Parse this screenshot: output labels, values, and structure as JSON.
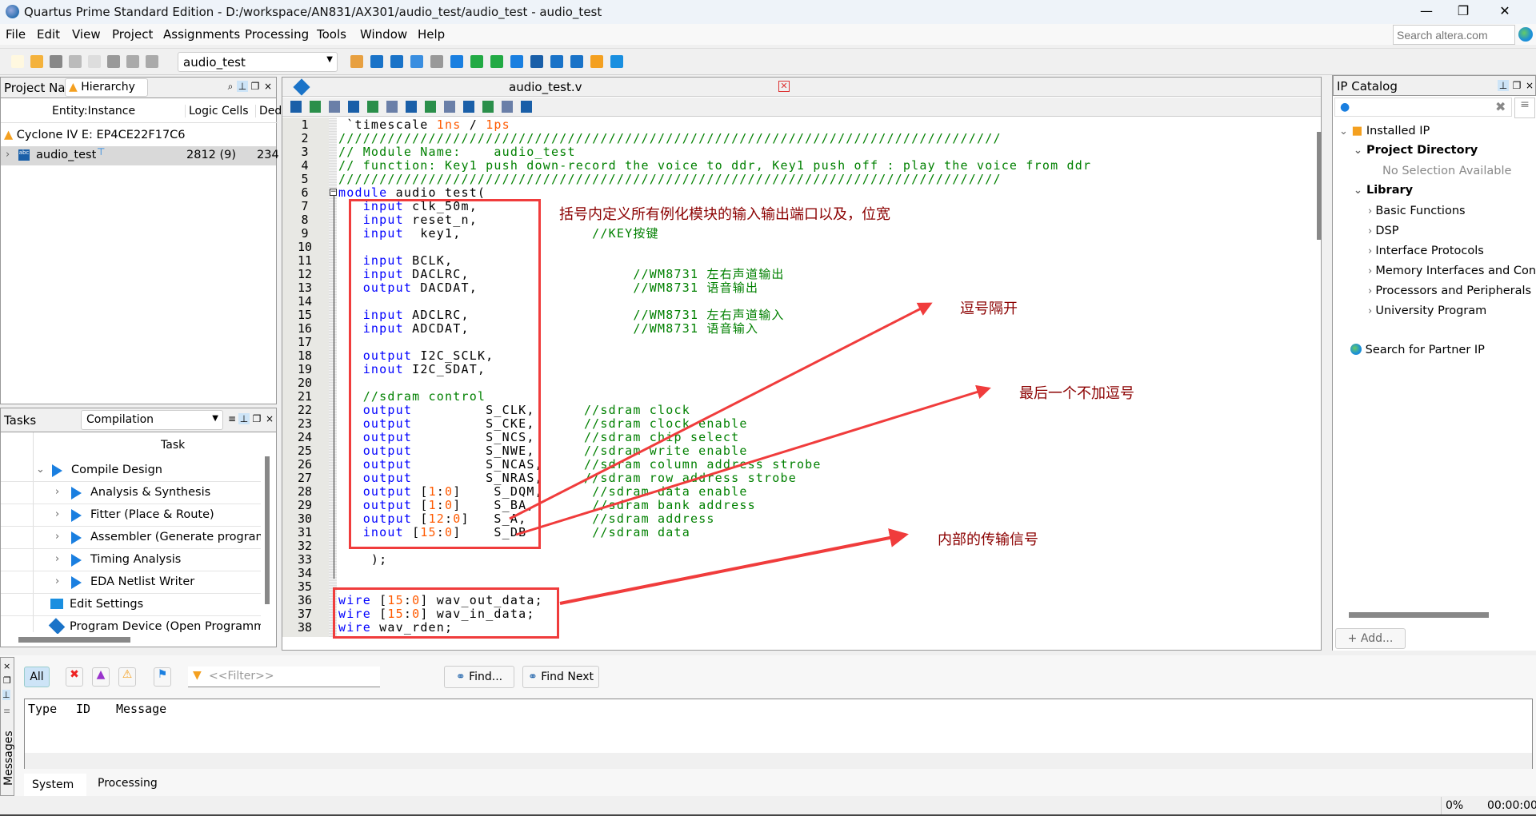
{
  "window": {
    "title": "Quartus Prime Standard Edition - D:/workspace/AN831/AX301/audio_test/audio_test - audio_test",
    "minimize": "—",
    "restore": "❐",
    "close": "✕"
  },
  "menu": [
    "File",
    "Edit",
    "View",
    "Project",
    "Assignments",
    "Processing",
    "Tools",
    "Window",
    "Help"
  ],
  "search": {
    "placeholder": "Search altera.com"
  },
  "toolbar": {
    "project_combo": "audio_test",
    "icons": [
      {
        "name": "new-file-icon",
        "color": "#fff8e0"
      },
      {
        "name": "open-folder-icon",
        "color": "#f4b23c"
      },
      {
        "name": "save-icon",
        "color": "#888"
      },
      {
        "name": "cut-icon",
        "color": "#bbb"
      },
      {
        "name": "copy-icon",
        "color": "#ddd"
      },
      {
        "name": "paste-icon",
        "color": "#999"
      },
      {
        "name": "undo-icon",
        "color": "#aaa"
      },
      {
        "name": "redo-icon",
        "color": "#aaa"
      }
    ],
    "icons2": [
      {
        "name": "pin-planner-edit-icon",
        "color": "#e8a040"
      },
      {
        "name": "assignment-editor-icon",
        "color": "#1a73c8"
      },
      {
        "name": "settings-icon",
        "color": "#1a73c8"
      },
      {
        "name": "chip-planner-icon",
        "color": "#3a8ee0"
      },
      {
        "name": "stop-icon",
        "color": "#999"
      },
      {
        "name": "start-compilation-icon",
        "color": "#1a7fe0"
      },
      {
        "name": "analysis-icon",
        "color": "#22aa44"
      },
      {
        "name": "fitter-icon",
        "color": "#22aa44"
      },
      {
        "name": "assembler-icon",
        "color": "#1a7fe0"
      },
      {
        "name": "timing-analyzer-icon",
        "color": "#1a5fa8"
      },
      {
        "name": "netlist-viewer-icon",
        "color": "#1a73c8"
      },
      {
        "name": "programmer-icon",
        "color": "#1a73c8"
      },
      {
        "name": "ip-catalog-icon",
        "color": "#f4a020"
      },
      {
        "name": "chat-icon",
        "color": "#1a8fe0"
      }
    ]
  },
  "navigator": {
    "title": "Project Navigator",
    "view": "Hierarchy",
    "columns": [
      "Entity:Instance",
      "Logic Cells",
      "Ded"
    ],
    "device": "Cyclone IV E: EP4CE22F17C6",
    "rows": [
      {
        "name": "audio_test",
        "cells": "2812 (9)",
        "ded": "234"
      }
    ]
  },
  "tasks": {
    "title": "Tasks",
    "flow": "Compilation",
    "column": "Task",
    "items": [
      {
        "label": "Compile Design",
        "level": 0,
        "expanded": true
      },
      {
        "label": "Analysis & Synthesis",
        "level": 1
      },
      {
        "label": "Fitter (Place & Route)",
        "level": 1
      },
      {
        "label": "Assembler (Generate programming files)",
        "level": 1
      },
      {
        "label": "Timing Analysis",
        "level": 1
      },
      {
        "label": "EDA Netlist Writer",
        "level": 1
      },
      {
        "label": "Edit Settings",
        "level": 2,
        "icon": "settings"
      },
      {
        "label": "Program Device (Open Programmer)",
        "level": 2,
        "icon": "program"
      }
    ]
  },
  "editor": {
    "tab": "audio_test.v",
    "lines": [
      [
        [
          "p",
          " `timescale "
        ],
        [
          "n",
          "1ns"
        ],
        [
          "p",
          " / "
        ],
        [
          "n",
          "1ps"
        ]
      ],
      [
        [
          "c",
          "/////////////////////////////////////////////////////////////////////////////////"
        ]
      ],
      [
        [
          "c",
          "// Module Name:    audio_test"
        ]
      ],
      [
        [
          "c",
          "// function: Key1 push down-record the voice to ddr, Key1 push off : play the voice from ddr"
        ]
      ],
      [
        [
          "c",
          "/////////////////////////////////////////////////////////////////////////////////"
        ]
      ],
      [
        [
          "k",
          "module"
        ],
        [
          "p",
          " audio_test("
        ]
      ],
      [
        [
          "p",
          "   "
        ],
        [
          "k",
          "input"
        ],
        [
          "p",
          " clk_50m,"
        ]
      ],
      [
        [
          "p",
          "   "
        ],
        [
          "k",
          "input"
        ],
        [
          "p",
          " reset_n,"
        ]
      ],
      [
        [
          "p",
          "   "
        ],
        [
          "k",
          "input"
        ],
        [
          "p",
          "  key1,                "
        ],
        [
          "c",
          "//KEY按键"
        ]
      ],
      [
        [
          "p",
          ""
        ]
      ],
      [
        [
          "p",
          "   "
        ],
        [
          "k",
          "input"
        ],
        [
          "p",
          " BCLK,"
        ]
      ],
      [
        [
          "p",
          "   "
        ],
        [
          "k",
          "input"
        ],
        [
          "p",
          " DACLRC,                    "
        ],
        [
          "c",
          "//WM8731 左右声道输出"
        ]
      ],
      [
        [
          "p",
          "   "
        ],
        [
          "k",
          "output"
        ],
        [
          "p",
          " DACDAT,                   "
        ],
        [
          "c",
          "//WM8731 语音输出"
        ]
      ],
      [
        [
          "p",
          ""
        ]
      ],
      [
        [
          "p",
          "   "
        ],
        [
          "k",
          "input"
        ],
        [
          "p",
          " ADCLRC,                    "
        ],
        [
          "c",
          "//WM8731 左右声道输入"
        ]
      ],
      [
        [
          "p",
          "   "
        ],
        [
          "k",
          "input"
        ],
        [
          "p",
          " ADCDAT,                    "
        ],
        [
          "c",
          "//WM8731 语音输入"
        ]
      ],
      [
        [
          "p",
          ""
        ]
      ],
      [
        [
          "p",
          "   "
        ],
        [
          "k",
          "output"
        ],
        [
          "p",
          " I2C_SCLK,"
        ]
      ],
      [
        [
          "p",
          "   "
        ],
        [
          "k",
          "inout"
        ],
        [
          "p",
          " I2C_SDAT,"
        ]
      ],
      [
        [
          "p",
          ""
        ]
      ],
      [
        [
          "p",
          "   "
        ],
        [
          "c",
          "//sdram control"
        ]
      ],
      [
        [
          "p",
          "   "
        ],
        [
          "k",
          "output"
        ],
        [
          "p",
          "         S_CLK,      "
        ],
        [
          "c",
          "//sdram clock"
        ]
      ],
      [
        [
          "p",
          "   "
        ],
        [
          "k",
          "output"
        ],
        [
          "p",
          "         S_CKE,      "
        ],
        [
          "c",
          "//sdram clock enable"
        ]
      ],
      [
        [
          "p",
          "   "
        ],
        [
          "k",
          "output"
        ],
        [
          "p",
          "         S_NCS,      "
        ],
        [
          "c",
          "//sdram chip select"
        ]
      ],
      [
        [
          "p",
          "   "
        ],
        [
          "k",
          "output"
        ],
        [
          "p",
          "         S_NWE,      "
        ],
        [
          "c",
          "//sdram write enable"
        ]
      ],
      [
        [
          "p",
          "   "
        ],
        [
          "k",
          "output"
        ],
        [
          "p",
          "         S_NCAS,     "
        ],
        [
          "c",
          "//sdram column address strobe"
        ]
      ],
      [
        [
          "p",
          "   "
        ],
        [
          "k",
          "output"
        ],
        [
          "p",
          "         S_NRAS,     "
        ],
        [
          "c",
          "//sdram row address strobe"
        ]
      ],
      [
        [
          "p",
          "   "
        ],
        [
          "k",
          "output"
        ],
        [
          "p",
          " ["
        ],
        [
          "n",
          "1"
        ],
        [
          "p",
          ":"
        ],
        [
          "n",
          "0"
        ],
        [
          "p",
          "]    S_DQM,      "
        ],
        [
          "c",
          "//sdram data enable"
        ]
      ],
      [
        [
          "p",
          "   "
        ],
        [
          "k",
          "output"
        ],
        [
          "p",
          " ["
        ],
        [
          "n",
          "1"
        ],
        [
          "p",
          ":"
        ],
        [
          "n",
          "0"
        ],
        [
          "p",
          "]    S_BA,       "
        ],
        [
          "c",
          "//sdram bank address"
        ]
      ],
      [
        [
          "p",
          "   "
        ],
        [
          "k",
          "output"
        ],
        [
          "p",
          " ["
        ],
        [
          "n",
          "12"
        ],
        [
          "p",
          ":"
        ],
        [
          "n",
          "0"
        ],
        [
          "p",
          "]   S_A,        "
        ],
        [
          "c",
          "//sdram address"
        ]
      ],
      [
        [
          "p",
          "   "
        ],
        [
          "k",
          "inout"
        ],
        [
          "p",
          " ["
        ],
        [
          "n",
          "15"
        ],
        [
          "p",
          ":"
        ],
        [
          "n",
          "0"
        ],
        [
          "p",
          "]    S_DB        "
        ],
        [
          "c",
          "//sdram data"
        ]
      ],
      [
        [
          "p",
          ""
        ]
      ],
      [
        [
          "p",
          "    );"
        ]
      ],
      [
        [
          "p",
          ""
        ]
      ],
      [
        [
          "p",
          ""
        ]
      ],
      [
        [
          "k",
          "wire"
        ],
        [
          "p",
          " ["
        ],
        [
          "n",
          "15"
        ],
        [
          "p",
          ":"
        ],
        [
          "n",
          "0"
        ],
        [
          "p",
          "] wav_out_data;"
        ]
      ],
      [
        [
          "k",
          "wire"
        ],
        [
          "p",
          " ["
        ],
        [
          "n",
          "15"
        ],
        [
          "p",
          ":"
        ],
        [
          "n",
          "0"
        ],
        [
          "p",
          "] wav_in_data;"
        ]
      ],
      [
        [
          "k",
          "wire"
        ],
        [
          "p",
          " wav_rden;"
        ]
      ]
    ]
  },
  "annotations": {
    "ports_note": "括号内定义所有例化模块的输入输出端口以及，位宽",
    "comma_note": "逗号隔开",
    "last_note": "最后一个不加逗号",
    "internal_note": "内部的传输信号",
    "color": "#f03c3c",
    "text_color": "#8b0000"
  },
  "ip_catalog": {
    "title": "IP Catalog",
    "installed": "Installed IP",
    "project_dir": "Project Directory",
    "no_selection": "No Selection Available",
    "library": "Library",
    "categories": [
      "Basic Functions",
      "DSP",
      "Interface Protocols",
      "Memory Interfaces and Controllers",
      "Processors and Peripherals",
      "University Program"
    ],
    "partner": "Search for Partner IP",
    "add": "Add..."
  },
  "messages": {
    "title": "Messages",
    "all": "All",
    "filter_placeholder": "<<Filter>>",
    "find": "Find...",
    "find_next": "Find Next",
    "columns": [
      "Type",
      "ID",
      "Message"
    ],
    "tabs": [
      "System",
      "Processing"
    ]
  },
  "status": {
    "progress": "0%",
    "time": "00:00:00"
  }
}
